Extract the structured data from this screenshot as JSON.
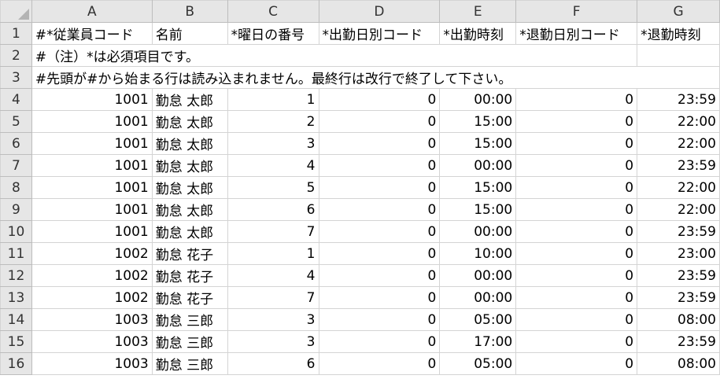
{
  "columns": [
    "A",
    "B",
    "C",
    "D",
    "E",
    "F",
    "G"
  ],
  "header_row": {
    "num": "1",
    "cells": [
      "#*従業員コード",
      "名前",
      "*曜日の番号",
      "*出勤日別コード",
      "*出勤時刻",
      "*退勤日別コード",
      "*退勤時刻"
    ]
  },
  "note_rows": [
    {
      "num": "2",
      "text": "#（注）*は必須項目です。"
    },
    {
      "num": "3",
      "text": "#先頭が#から始まる行は読み込まれません。最終行は改行で終了して下さい。"
    }
  ],
  "rows": [
    {
      "num": "4",
      "code": "1001",
      "name": "勤怠 太郎",
      "weekday": "1",
      "in_code": "0",
      "in_time": "00:00",
      "out_code": "0",
      "out_time": "23:59"
    },
    {
      "num": "5",
      "code": "1001",
      "name": "勤怠 太郎",
      "weekday": "2",
      "in_code": "0",
      "in_time": "15:00",
      "out_code": "0",
      "out_time": "22:00"
    },
    {
      "num": "6",
      "code": "1001",
      "name": "勤怠 太郎",
      "weekday": "3",
      "in_code": "0",
      "in_time": "15:00",
      "out_code": "0",
      "out_time": "22:00"
    },
    {
      "num": "7",
      "code": "1001",
      "name": "勤怠 太郎",
      "weekday": "4",
      "in_code": "0",
      "in_time": "00:00",
      "out_code": "0",
      "out_time": "23:59"
    },
    {
      "num": "8",
      "code": "1001",
      "name": "勤怠 太郎",
      "weekday": "5",
      "in_code": "0",
      "in_time": "15:00",
      "out_code": "0",
      "out_time": "22:00"
    },
    {
      "num": "9",
      "code": "1001",
      "name": "勤怠 太郎",
      "weekday": "6",
      "in_code": "0",
      "in_time": "15:00",
      "out_code": "0",
      "out_time": "22:00"
    },
    {
      "num": "10",
      "code": "1001",
      "name": "勤怠 太郎",
      "weekday": "7",
      "in_code": "0",
      "in_time": "00:00",
      "out_code": "0",
      "out_time": "23:59"
    },
    {
      "num": "11",
      "code": "1002",
      "name": "勤怠 花子",
      "weekday": "1",
      "in_code": "0",
      "in_time": "10:00",
      "out_code": "0",
      "out_time": "23:00"
    },
    {
      "num": "12",
      "code": "1002",
      "name": "勤怠 花子",
      "weekday": "4",
      "in_code": "0",
      "in_time": "00:00",
      "out_code": "0",
      "out_time": "23:59"
    },
    {
      "num": "13",
      "code": "1002",
      "name": "勤怠 花子",
      "weekday": "7",
      "in_code": "0",
      "in_time": "00:00",
      "out_code": "0",
      "out_time": "23:59"
    },
    {
      "num": "14",
      "code": "1003",
      "name": "勤怠 三郎",
      "weekday": "3",
      "in_code": "0",
      "in_time": "05:00",
      "out_code": "0",
      "out_time": "08:00"
    },
    {
      "num": "15",
      "code": "1003",
      "name": "勤怠 三郎",
      "weekday": "3",
      "in_code": "0",
      "in_time": "17:00",
      "out_code": "0",
      "out_time": "23:59"
    },
    {
      "num": "16",
      "code": "1003",
      "name": "勤怠 三郎",
      "weekday": "6",
      "in_code": "0",
      "in_time": "05:00",
      "out_code": "0",
      "out_time": "08:00"
    }
  ]
}
